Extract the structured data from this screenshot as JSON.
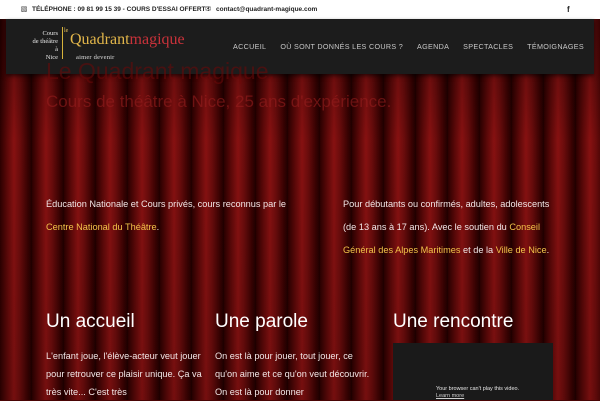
{
  "topbar": {
    "phone": "TÉLÉPHONE : 09 81 99 15 39 - COURS D'ESSAI OFFERT !",
    "email": "contact@quadrant-magique.com",
    "facebook": "f"
  },
  "logo": {
    "left_text": [
      "Cours",
      "de théâtre",
      "à",
      "Nice"
    ],
    "mark": "le",
    "brand_q": "Quadrant",
    "brand_m": "magique",
    "tagline": "aimer  devenir"
  },
  "menu": [
    "ACCUEIL",
    "OÙ SONT DONNÉS LES COURS ?",
    "AGENDA",
    "SPECTACLES",
    "TÉMOIGNAGES"
  ],
  "hero": {
    "title": "Le Quadrant magique.",
    "subtitle": "Cours de théâtre à Nice, 25 ans d'expérience."
  },
  "intro_left": {
    "text1": "Éducation Nationale et Cours privés, cours reconnus par le ",
    "link": "Centre National du Théâtre",
    "text2": "."
  },
  "intro_right": {
    "text1": "Pour débutants ou confirmés, adultes, adolescents (de 13 ans à 17 ans). Avec le soutien du ",
    "link1": "Conseil Général des Alpes Maritimes",
    "text2": " et de la ",
    "link2": "Ville de Nice",
    "text3": "."
  },
  "columns": [
    {
      "title": "Un accueil",
      "text": "L'enfant joue, l'élève-acteur veut jouer pour retrouver ce plaisir unique. Ça va très vite... C'est très"
    },
    {
      "title": "Une parole",
      "text": "On est là pour jouer, tout jouer, ce qu'on aime et ce qu'on veut découvrir. On est là pour donner"
    },
    {
      "title": "Une rencontre",
      "text": ""
    }
  ],
  "video": {
    "message": "Your browser can't play this video.",
    "link": "Learn more"
  }
}
